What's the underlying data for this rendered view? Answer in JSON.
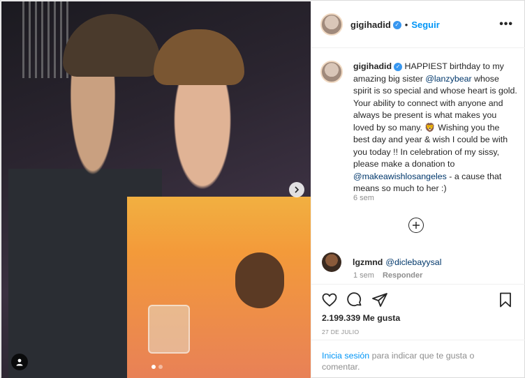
{
  "post": {
    "username": "gigihadid",
    "follow_label": "Seguir",
    "separator": "•",
    "more_icon": "ellipsis-icon"
  },
  "caption": {
    "username": "gigihadid",
    "text_1": "HAPPIEST birthday to my amazing big sister ",
    "mention_1": "@lanzybear",
    "text_2": " whose spirit is so special and whose heart is gold. Your ability to connect with anyone and always be present is what makes you loved by so many. 🦁 Wishing you the best day and year & wish I could be with you today !! In celebration of my sissy, please make a donation to ",
    "mention_2": "@makeawishlosangeles",
    "text_3": " - a cause that means so much to her :)",
    "time": "6 sem"
  },
  "comment": {
    "username": "lgzmnd",
    "mention": "@diclebayysal",
    "time": "1 sem",
    "reply_label": "Responder"
  },
  "actions": {
    "like_icon": "heart-icon",
    "comment_icon": "speech-bubble-icon",
    "share_icon": "paper-plane-icon",
    "save_icon": "bookmark-icon"
  },
  "likes": "2.199.339 Me gusta",
  "date": "27 DE JULIO",
  "login": {
    "link_label": "Inicia sesión",
    "text": " para indicar que te gusta o comentar."
  },
  "colors": {
    "link": "#0095f6",
    "mention": "#00376b",
    "muted": "#8e8e8e",
    "verified": "#3897f0"
  }
}
